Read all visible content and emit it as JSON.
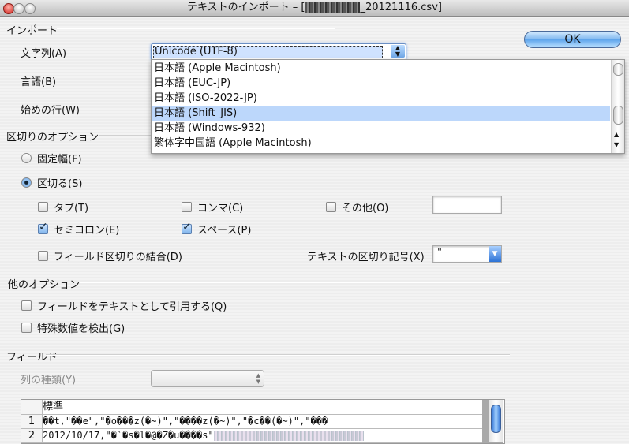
{
  "window": {
    "title_prefix": "テキストのインポート – [",
    "title_suffix": "_20121116.csv]"
  },
  "import": {
    "section": "インポート",
    "encoding_label": "文字列(A)",
    "encoding_value": "Unicode (UTF-8)",
    "language_label": "言語(B)",
    "start_row_label": "始めの行(W)",
    "encoding_options": [
      {
        "label": "日本語 (Apple Macintosh)",
        "selected": false
      },
      {
        "label": "日本語 (EUC-JP)",
        "selected": false
      },
      {
        "label": "日本語 (ISO-2022-JP)",
        "selected": false
      },
      {
        "label": "日本語 (Shift_JIS)",
        "selected": true
      },
      {
        "label": "日本語 (Windows-932)",
        "selected": false
      },
      {
        "label": "繁体字中国語 (Apple Macintosh)",
        "selected": false
      }
    ]
  },
  "ok_label": "OK",
  "separator": {
    "section": "区切りのオプション",
    "fixed_width": "固定幅(F)",
    "delimited": "区切る(S)",
    "tab": "タブ(T)",
    "comma": "コンマ(C)",
    "other": "その他(O)",
    "semicolon": "セミコロン(E)",
    "space": "スペース(P)",
    "merge": "フィールド区切りの結合(D)",
    "text_delimiter_label": "テキストの区切り記号(X)",
    "text_delimiter_value": "\""
  },
  "other_options": {
    "section": "他のオプション",
    "quote_as_text": "フィールドをテキストとして引用する(Q)",
    "detect_special": "特殊数値を検出(G)"
  },
  "fields": {
    "section": "フィールド",
    "column_type_label": "列の種類(Y)",
    "header": "標準",
    "rows": [
      {
        "num": "1",
        "text": "��t,\"��e\",\"�o���z(�~)\",\"����z(�~)\",\"�c��(�~)\",\"���"
      },
      {
        "num": "2",
        "text": "2012/10/17,\"�`�s�l�@�Z�u����s\""
      }
    ]
  }
}
